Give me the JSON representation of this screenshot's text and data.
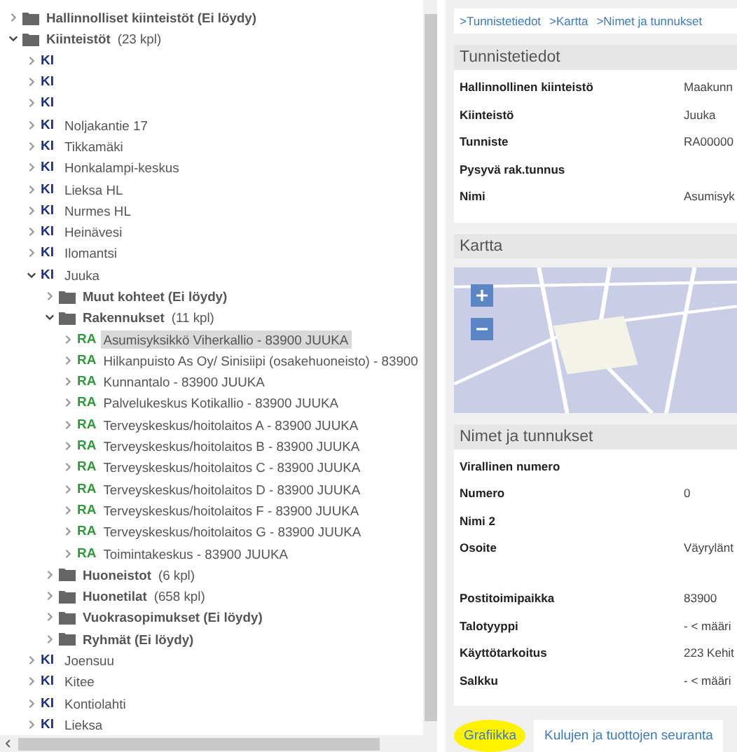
{
  "tree": [
    {
      "kind": "folder",
      "label": "Hallinnolliset kiinteistöt (Ei löydy)",
      "expanded": false,
      "selected": false
    },
    {
      "kind": "folder",
      "label": "Kiinteistöt",
      "count": "(23 kpl)",
      "expanded": true,
      "selected": false,
      "children": [
        {
          "kind": "ki",
          "badge": "KI",
          "expanded": false,
          "selected": false
        },
        {
          "kind": "ki",
          "badge": "KI",
          "expanded": false,
          "selected": false
        },
        {
          "kind": "ki",
          "badge": "KI",
          "expanded": false,
          "selected": false
        },
        {
          "kind": "ki",
          "badge": "KI",
          "label": "Noljakantie 17",
          "expanded": false,
          "selected": false
        },
        {
          "kind": "ki",
          "badge": "KI",
          "label": "Tikkamäki",
          "expanded": false,
          "selected": false
        },
        {
          "kind": "ki",
          "badge": "KI",
          "label": "Honkalampi-keskus",
          "expanded": false,
          "selected": false
        },
        {
          "kind": "ki",
          "badge": "KI",
          "label": "Lieksa HL",
          "expanded": false,
          "selected": false
        },
        {
          "kind": "ki",
          "badge": "KI",
          "label": "Nurmes HL",
          "expanded": false,
          "selected": false
        },
        {
          "kind": "ki",
          "badge": "KI",
          "label": "Heinävesi",
          "expanded": false,
          "selected": false
        },
        {
          "kind": "ki",
          "badge": "KI",
          "label": "Ilomantsi",
          "expanded": false,
          "selected": false
        },
        {
          "kind": "ki",
          "badge": "KI",
          "label": "Juuka",
          "expanded": true,
          "selected": false,
          "children": [
            {
              "kind": "folder",
              "label": "Muut kohteet (Ei löydy)",
              "expanded": false,
              "selected": false
            },
            {
              "kind": "folder",
              "label": "Rakennukset",
              "count": "(11 kpl)",
              "expanded": true,
              "selected": false,
              "children": [
                {
                  "kind": "ra",
                  "badge": "RA",
                  "label": "Asumisyksikkö Viherkallio - 83900 JUUKA",
                  "expanded": false,
                  "selected": true
                },
                {
                  "kind": "ra",
                  "badge": "RA",
                  "label": "Hilkanpuisto As Oy/ Sinisiipi (osakehuoneisto) - 83900",
                  "expanded": false,
                  "selected": false
                },
                {
                  "kind": "ra",
                  "badge": "RA",
                  "label": "Kunnantalo - 83900 JUUKA",
                  "expanded": false,
                  "selected": false
                },
                {
                  "kind": "ra",
                  "badge": "RA",
                  "label": "Palvelukeskus Kotikallio - 83900 JUUKA",
                  "expanded": false,
                  "selected": false
                },
                {
                  "kind": "ra",
                  "badge": "RA",
                  "label": "Terveyskeskus/hoitolaitos A - 83900 JUUKA",
                  "expanded": false,
                  "selected": false
                },
                {
                  "kind": "ra",
                  "badge": "RA",
                  "label": "Terveyskeskus/hoitolaitos B - 83900 JUUKA",
                  "expanded": false,
                  "selected": false
                },
                {
                  "kind": "ra",
                  "badge": "RA",
                  "label": "Terveyskeskus/hoitolaitos C - 83900 JUUKA",
                  "expanded": false,
                  "selected": false
                },
                {
                  "kind": "ra",
                  "badge": "RA",
                  "label": "Terveyskeskus/hoitolaitos D - 83900 JUUKA",
                  "expanded": false,
                  "selected": false
                },
                {
                  "kind": "ra",
                  "badge": "RA",
                  "label": "Terveyskeskus/hoitolaitos F - 83900 JUUKA",
                  "expanded": false,
                  "selected": false
                },
                {
                  "kind": "ra",
                  "badge": "RA",
                  "label": "Terveyskeskus/hoitolaitos G - 83900 JUUKA",
                  "expanded": false,
                  "selected": false
                },
                {
                  "kind": "ra",
                  "badge": "RA",
                  "label": "Toimintakeskus - 83900 JUUKA",
                  "expanded": false,
                  "selected": false
                }
              ]
            },
            {
              "kind": "folder",
              "label": "Huoneistot",
              "count": "(6 kpl)",
              "expanded": false,
              "selected": false
            },
            {
              "kind": "folder",
              "label": "Huonetilat",
              "count": "(658 kpl)",
              "expanded": false,
              "selected": false
            },
            {
              "kind": "folder",
              "label": "Vuokrasopimukset (Ei löydy)",
              "expanded": false,
              "selected": false
            },
            {
              "kind": "folder",
              "label": "Ryhmät (Ei löydy)",
              "expanded": false,
              "selected": false
            }
          ]
        },
        {
          "kind": "ki",
          "badge": "KI",
          "label": "Joensuu",
          "expanded": false,
          "selected": false
        },
        {
          "kind": "ki",
          "badge": "KI",
          "label": "Kitee",
          "expanded": false,
          "selected": false
        },
        {
          "kind": "ki",
          "badge": "KI",
          "label": "Kontiolahti",
          "expanded": false,
          "selected": false
        },
        {
          "kind": "ki",
          "badge": "KI",
          "label": "Lieksa",
          "expanded": false,
          "selected": false
        }
      ]
    }
  ],
  "breadcrumbs": [
    ">Tunnistetiedot",
    ">Kartta",
    ">Nimet ja tunnukset"
  ],
  "identification": {
    "title": "Tunnistetiedot",
    "rows": [
      {
        "label": "Hallinnollinen kiinteistö",
        "value": "Maakunn"
      },
      {
        "label": "Kiinteistö",
        "value": "Juuka"
      },
      {
        "label": "Tunniste",
        "value": "RA00000"
      },
      {
        "label": "Pysyvä rak.tunnus"
      },
      {
        "label": "Nimi",
        "value": "Asumisyk"
      }
    ]
  },
  "map": {
    "title": "Kartta"
  },
  "names": {
    "title": "Nimet ja tunnukset",
    "rows": [
      {
        "label": "Virallinen numero"
      },
      {
        "label": "Numero",
        "value": "0"
      },
      {
        "label": "Nimi 2"
      },
      {
        "label": "Osoite",
        "value": "Väyrylänt",
        "tall": true
      },
      {
        "label": "Postitoimipaikka",
        "value": "83900"
      },
      {
        "label": "Talotyyppi",
        "value": "- < määri"
      },
      {
        "label": "Käyttötarkoitus",
        "value": "223 Kehit"
      },
      {
        "label": "Salkku",
        "value": "- < määri"
      }
    ]
  },
  "buttons": [
    {
      "label": "Grafiikka",
      "highlighted": true
    },
    {
      "label": "Kulujen ja tuottojen seuranta",
      "highlighted": false
    }
  ]
}
